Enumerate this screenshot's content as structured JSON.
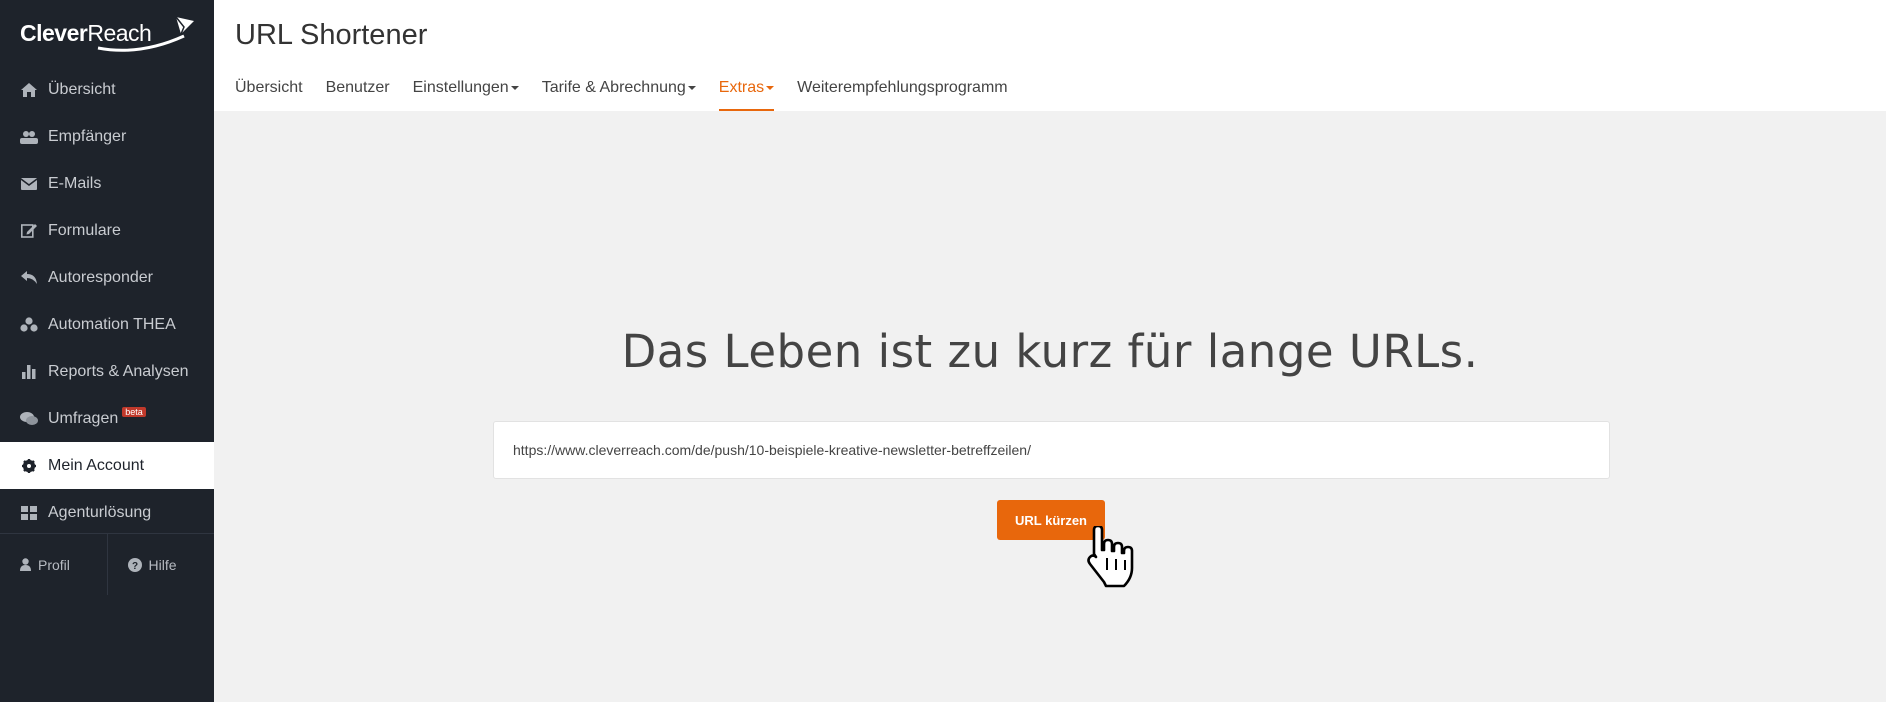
{
  "brand": {
    "logo_bold": "Clever",
    "logo_regular": "Reach",
    "accent_color": "#e8670c",
    "sidebar_bg": "#1e232b"
  },
  "sidebar": {
    "items": [
      {
        "label": "Übersicht",
        "icon": "home-icon"
      },
      {
        "label": "Empfänger",
        "icon": "users-icon"
      },
      {
        "label": "E-Mails",
        "icon": "envelope-icon"
      },
      {
        "label": "Formulare",
        "icon": "edit-icon"
      },
      {
        "label": "Autoresponder",
        "icon": "reply-icon"
      },
      {
        "label": "Automation THEA",
        "icon": "cubes-icon"
      },
      {
        "label": "Reports & Analysen",
        "icon": "bar-chart-icon"
      },
      {
        "label": "Umfragen",
        "icon": "comments-icon",
        "badge": "beta"
      },
      {
        "label": "Mein Account",
        "icon": "gear-icon",
        "active": true
      },
      {
        "label": "Agenturlösung",
        "icon": "grid-icon"
      }
    ],
    "footer": [
      {
        "label": "Profil",
        "icon": "user-icon"
      },
      {
        "label": "Hilfe",
        "icon": "question-icon"
      }
    ]
  },
  "header": {
    "title": "URL Shortener",
    "tabs": [
      {
        "label": "Übersicht"
      },
      {
        "label": "Benutzer"
      },
      {
        "label": "Einstellungen",
        "dropdown": true
      },
      {
        "label": "Tarife & Abrechnung",
        "dropdown": true
      },
      {
        "label": "Extras",
        "dropdown": true,
        "active": true
      },
      {
        "label": "Weiterempfehlungsprogramm"
      }
    ]
  },
  "main": {
    "headline": "Das Leben ist zu kurz für lange URLs.",
    "url_value": "https://www.cleverreach.com/de/push/10-beispiele-kreative-newsletter-betreffzeilen/",
    "button_label": "URL kürzen"
  }
}
